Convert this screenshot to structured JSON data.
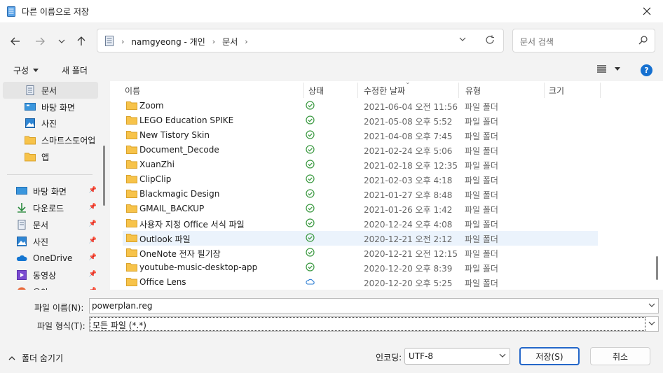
{
  "window": {
    "title": "다른 이름으로 저장"
  },
  "nav": {
    "back_icon": "arrow-left-icon",
    "forward_icon": "arrow-right-icon",
    "recent_icon": "chevron-down-icon",
    "up_icon": "arrow-up-icon"
  },
  "address": {
    "crumbs": [
      "namgyeong - 개인",
      "문서"
    ]
  },
  "search": {
    "placeholder": "문서 검색"
  },
  "toolbar": {
    "organize": "구성",
    "new_folder": "새 폴더",
    "help": "?"
  },
  "sidebar": {
    "top_items": [
      {
        "label": "문서",
        "icon": "documents-icon"
      },
      {
        "label": "바탕 화면",
        "icon": "desktop-icon"
      },
      {
        "label": "사진",
        "icon": "pictures-icon"
      },
      {
        "label": "스마트스토어업",
        "icon": "folder-icon"
      },
      {
        "label": "앱",
        "icon": "folder-icon"
      }
    ],
    "pinned_items": [
      {
        "label": "바탕 화면",
        "icon": "desktop-icon"
      },
      {
        "label": "다운로드",
        "icon": "download-icon"
      },
      {
        "label": "문서",
        "icon": "documents-icon"
      },
      {
        "label": "사진",
        "icon": "pictures-icon"
      },
      {
        "label": "OneDrive",
        "icon": "onedrive-icon"
      },
      {
        "label": "동영상",
        "icon": "videos-icon"
      },
      {
        "label": "음악",
        "icon": "music-icon"
      }
    ]
  },
  "columns": {
    "name": "이름",
    "status": "상태",
    "date": "수정한 날짜",
    "type": "유형",
    "size": "크기"
  },
  "files": [
    {
      "name": "Zoom",
      "status": "synced",
      "date": "2021-06-04 오전 11:56",
      "type": "파일 폴더"
    },
    {
      "name": "LEGO Education SPIKE",
      "status": "synced",
      "date": "2021-05-08 오후 5:52",
      "type": "파일 폴더"
    },
    {
      "name": "New Tistory Skin",
      "status": "synced",
      "date": "2021-04-08 오후 7:45",
      "type": "파일 폴더"
    },
    {
      "name": "Document_Decode",
      "status": "synced",
      "date": "2021-02-24 오후 5:06",
      "type": "파일 폴더"
    },
    {
      "name": "XuanZhi",
      "status": "synced",
      "date": "2021-02-18 오후 12:35",
      "type": "파일 폴더"
    },
    {
      "name": "ClipClip",
      "status": "synced",
      "date": "2021-02-03 오후 4:18",
      "type": "파일 폴더"
    },
    {
      "name": "Blackmagic Design",
      "status": "synced",
      "date": "2021-01-27 오후 8:48",
      "type": "파일 폴더"
    },
    {
      "name": "GMAIL_BACKUP",
      "status": "synced",
      "date": "2021-01-26 오후 1:42",
      "type": "파일 폴더"
    },
    {
      "name": "사용자 지정 Office 서식 파일",
      "status": "synced",
      "date": "2020-12-24 오후 4:08",
      "type": "파일 폴더"
    },
    {
      "name": "Outlook 파일",
      "status": "synced",
      "date": "2020-12-21 오전 2:12",
      "type": "파일 폴더",
      "selected": true
    },
    {
      "name": "OneNote 전자 필기장",
      "status": "synced",
      "date": "2020-12-21 오전 12:15",
      "type": "파일 폴더"
    },
    {
      "name": "youtube-music-desktop-app",
      "status": "synced",
      "date": "2020-12-20 오후 8:39",
      "type": "파일 폴더"
    },
    {
      "name": "Office Lens",
      "status": "cloud",
      "date": "2020-12-20 오후 5:25",
      "type": "파일 폴더"
    }
  ],
  "form": {
    "filename_label": "파일 이름(N):",
    "filename_value": "powerplan.reg",
    "filetype_label": "파일 형식(T):",
    "filetype_value": "모든 파일  (*.*)",
    "hide_folders": "폴더 숨기기",
    "encoding_label": "인코딩:",
    "encoding_value": "UTF-8",
    "save": "저장(S)",
    "cancel": "취소"
  },
  "colors": {
    "accent": "#2467c9",
    "folder": "#f7c34a",
    "sync_green": "#3c9a42",
    "cloud_blue": "#2b7cd3"
  }
}
